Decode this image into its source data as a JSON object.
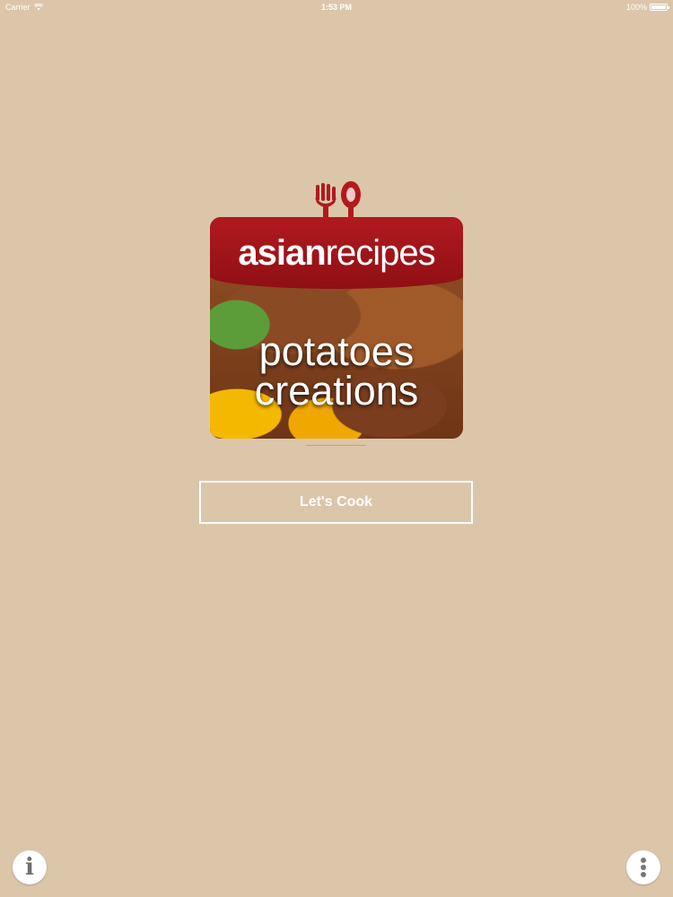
{
  "status_bar": {
    "carrier": "Carrier",
    "time": "1:53 PM",
    "battery": "100%"
  },
  "logo": {
    "brand_part1": "asian",
    "brand_part2": "recipes",
    "title_line1": "potatoes",
    "title_line2": "creations"
  },
  "main": {
    "cook_button_label": "Let's Cook"
  },
  "footer": {
    "info_icon": "i",
    "more_icon": "vertical-ellipsis"
  },
  "colors": {
    "background": "#dcc6aa",
    "banner_red": "#b11a1f",
    "button_border": "#ffffff"
  }
}
